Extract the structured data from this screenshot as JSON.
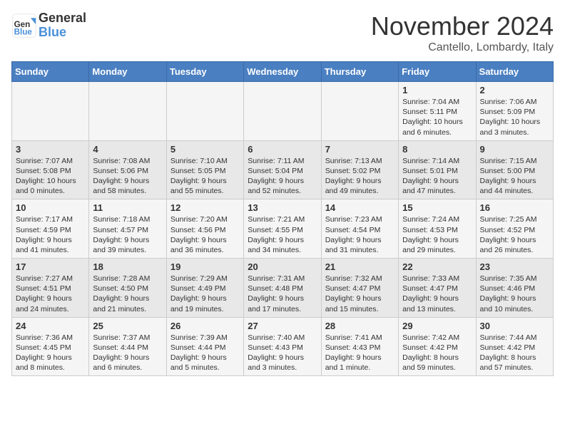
{
  "header": {
    "logo_general": "General",
    "logo_blue": "Blue",
    "month_title": "November 2024",
    "location": "Cantello, Lombardy, Italy"
  },
  "weekdays": [
    "Sunday",
    "Monday",
    "Tuesday",
    "Wednesday",
    "Thursday",
    "Friday",
    "Saturday"
  ],
  "weeks": [
    [
      {
        "day": "",
        "info": ""
      },
      {
        "day": "",
        "info": ""
      },
      {
        "day": "",
        "info": ""
      },
      {
        "day": "",
        "info": ""
      },
      {
        "day": "",
        "info": ""
      },
      {
        "day": "1",
        "info": "Sunrise: 7:04 AM\nSunset: 5:11 PM\nDaylight: 10 hours and 6 minutes."
      },
      {
        "day": "2",
        "info": "Sunrise: 7:06 AM\nSunset: 5:09 PM\nDaylight: 10 hours and 3 minutes."
      }
    ],
    [
      {
        "day": "3",
        "info": "Sunrise: 7:07 AM\nSunset: 5:08 PM\nDaylight: 10 hours and 0 minutes."
      },
      {
        "day": "4",
        "info": "Sunrise: 7:08 AM\nSunset: 5:06 PM\nDaylight: 9 hours and 58 minutes."
      },
      {
        "day": "5",
        "info": "Sunrise: 7:10 AM\nSunset: 5:05 PM\nDaylight: 9 hours and 55 minutes."
      },
      {
        "day": "6",
        "info": "Sunrise: 7:11 AM\nSunset: 5:04 PM\nDaylight: 9 hours and 52 minutes."
      },
      {
        "day": "7",
        "info": "Sunrise: 7:13 AM\nSunset: 5:02 PM\nDaylight: 9 hours and 49 minutes."
      },
      {
        "day": "8",
        "info": "Sunrise: 7:14 AM\nSunset: 5:01 PM\nDaylight: 9 hours and 47 minutes."
      },
      {
        "day": "9",
        "info": "Sunrise: 7:15 AM\nSunset: 5:00 PM\nDaylight: 9 hours and 44 minutes."
      }
    ],
    [
      {
        "day": "10",
        "info": "Sunrise: 7:17 AM\nSunset: 4:59 PM\nDaylight: 9 hours and 41 minutes."
      },
      {
        "day": "11",
        "info": "Sunrise: 7:18 AM\nSunset: 4:57 PM\nDaylight: 9 hours and 39 minutes."
      },
      {
        "day": "12",
        "info": "Sunrise: 7:20 AM\nSunset: 4:56 PM\nDaylight: 9 hours and 36 minutes."
      },
      {
        "day": "13",
        "info": "Sunrise: 7:21 AM\nSunset: 4:55 PM\nDaylight: 9 hours and 34 minutes."
      },
      {
        "day": "14",
        "info": "Sunrise: 7:23 AM\nSunset: 4:54 PM\nDaylight: 9 hours and 31 minutes."
      },
      {
        "day": "15",
        "info": "Sunrise: 7:24 AM\nSunset: 4:53 PM\nDaylight: 9 hours and 29 minutes."
      },
      {
        "day": "16",
        "info": "Sunrise: 7:25 AM\nSunset: 4:52 PM\nDaylight: 9 hours and 26 minutes."
      }
    ],
    [
      {
        "day": "17",
        "info": "Sunrise: 7:27 AM\nSunset: 4:51 PM\nDaylight: 9 hours and 24 minutes."
      },
      {
        "day": "18",
        "info": "Sunrise: 7:28 AM\nSunset: 4:50 PM\nDaylight: 9 hours and 21 minutes."
      },
      {
        "day": "19",
        "info": "Sunrise: 7:29 AM\nSunset: 4:49 PM\nDaylight: 9 hours and 19 minutes."
      },
      {
        "day": "20",
        "info": "Sunrise: 7:31 AM\nSunset: 4:48 PM\nDaylight: 9 hours and 17 minutes."
      },
      {
        "day": "21",
        "info": "Sunrise: 7:32 AM\nSunset: 4:47 PM\nDaylight: 9 hours and 15 minutes."
      },
      {
        "day": "22",
        "info": "Sunrise: 7:33 AM\nSunset: 4:47 PM\nDaylight: 9 hours and 13 minutes."
      },
      {
        "day": "23",
        "info": "Sunrise: 7:35 AM\nSunset: 4:46 PM\nDaylight: 9 hours and 10 minutes."
      }
    ],
    [
      {
        "day": "24",
        "info": "Sunrise: 7:36 AM\nSunset: 4:45 PM\nDaylight: 9 hours and 8 minutes."
      },
      {
        "day": "25",
        "info": "Sunrise: 7:37 AM\nSunset: 4:44 PM\nDaylight: 9 hours and 6 minutes."
      },
      {
        "day": "26",
        "info": "Sunrise: 7:39 AM\nSunset: 4:44 PM\nDaylight: 9 hours and 5 minutes."
      },
      {
        "day": "27",
        "info": "Sunrise: 7:40 AM\nSunset: 4:43 PM\nDaylight: 9 hours and 3 minutes."
      },
      {
        "day": "28",
        "info": "Sunrise: 7:41 AM\nSunset: 4:43 PM\nDaylight: 9 hours and 1 minute."
      },
      {
        "day": "29",
        "info": "Sunrise: 7:42 AM\nSunset: 4:42 PM\nDaylight: 8 hours and 59 minutes."
      },
      {
        "day": "30",
        "info": "Sunrise: 7:44 AM\nSunset: 4:42 PM\nDaylight: 8 hours and 57 minutes."
      }
    ]
  ]
}
